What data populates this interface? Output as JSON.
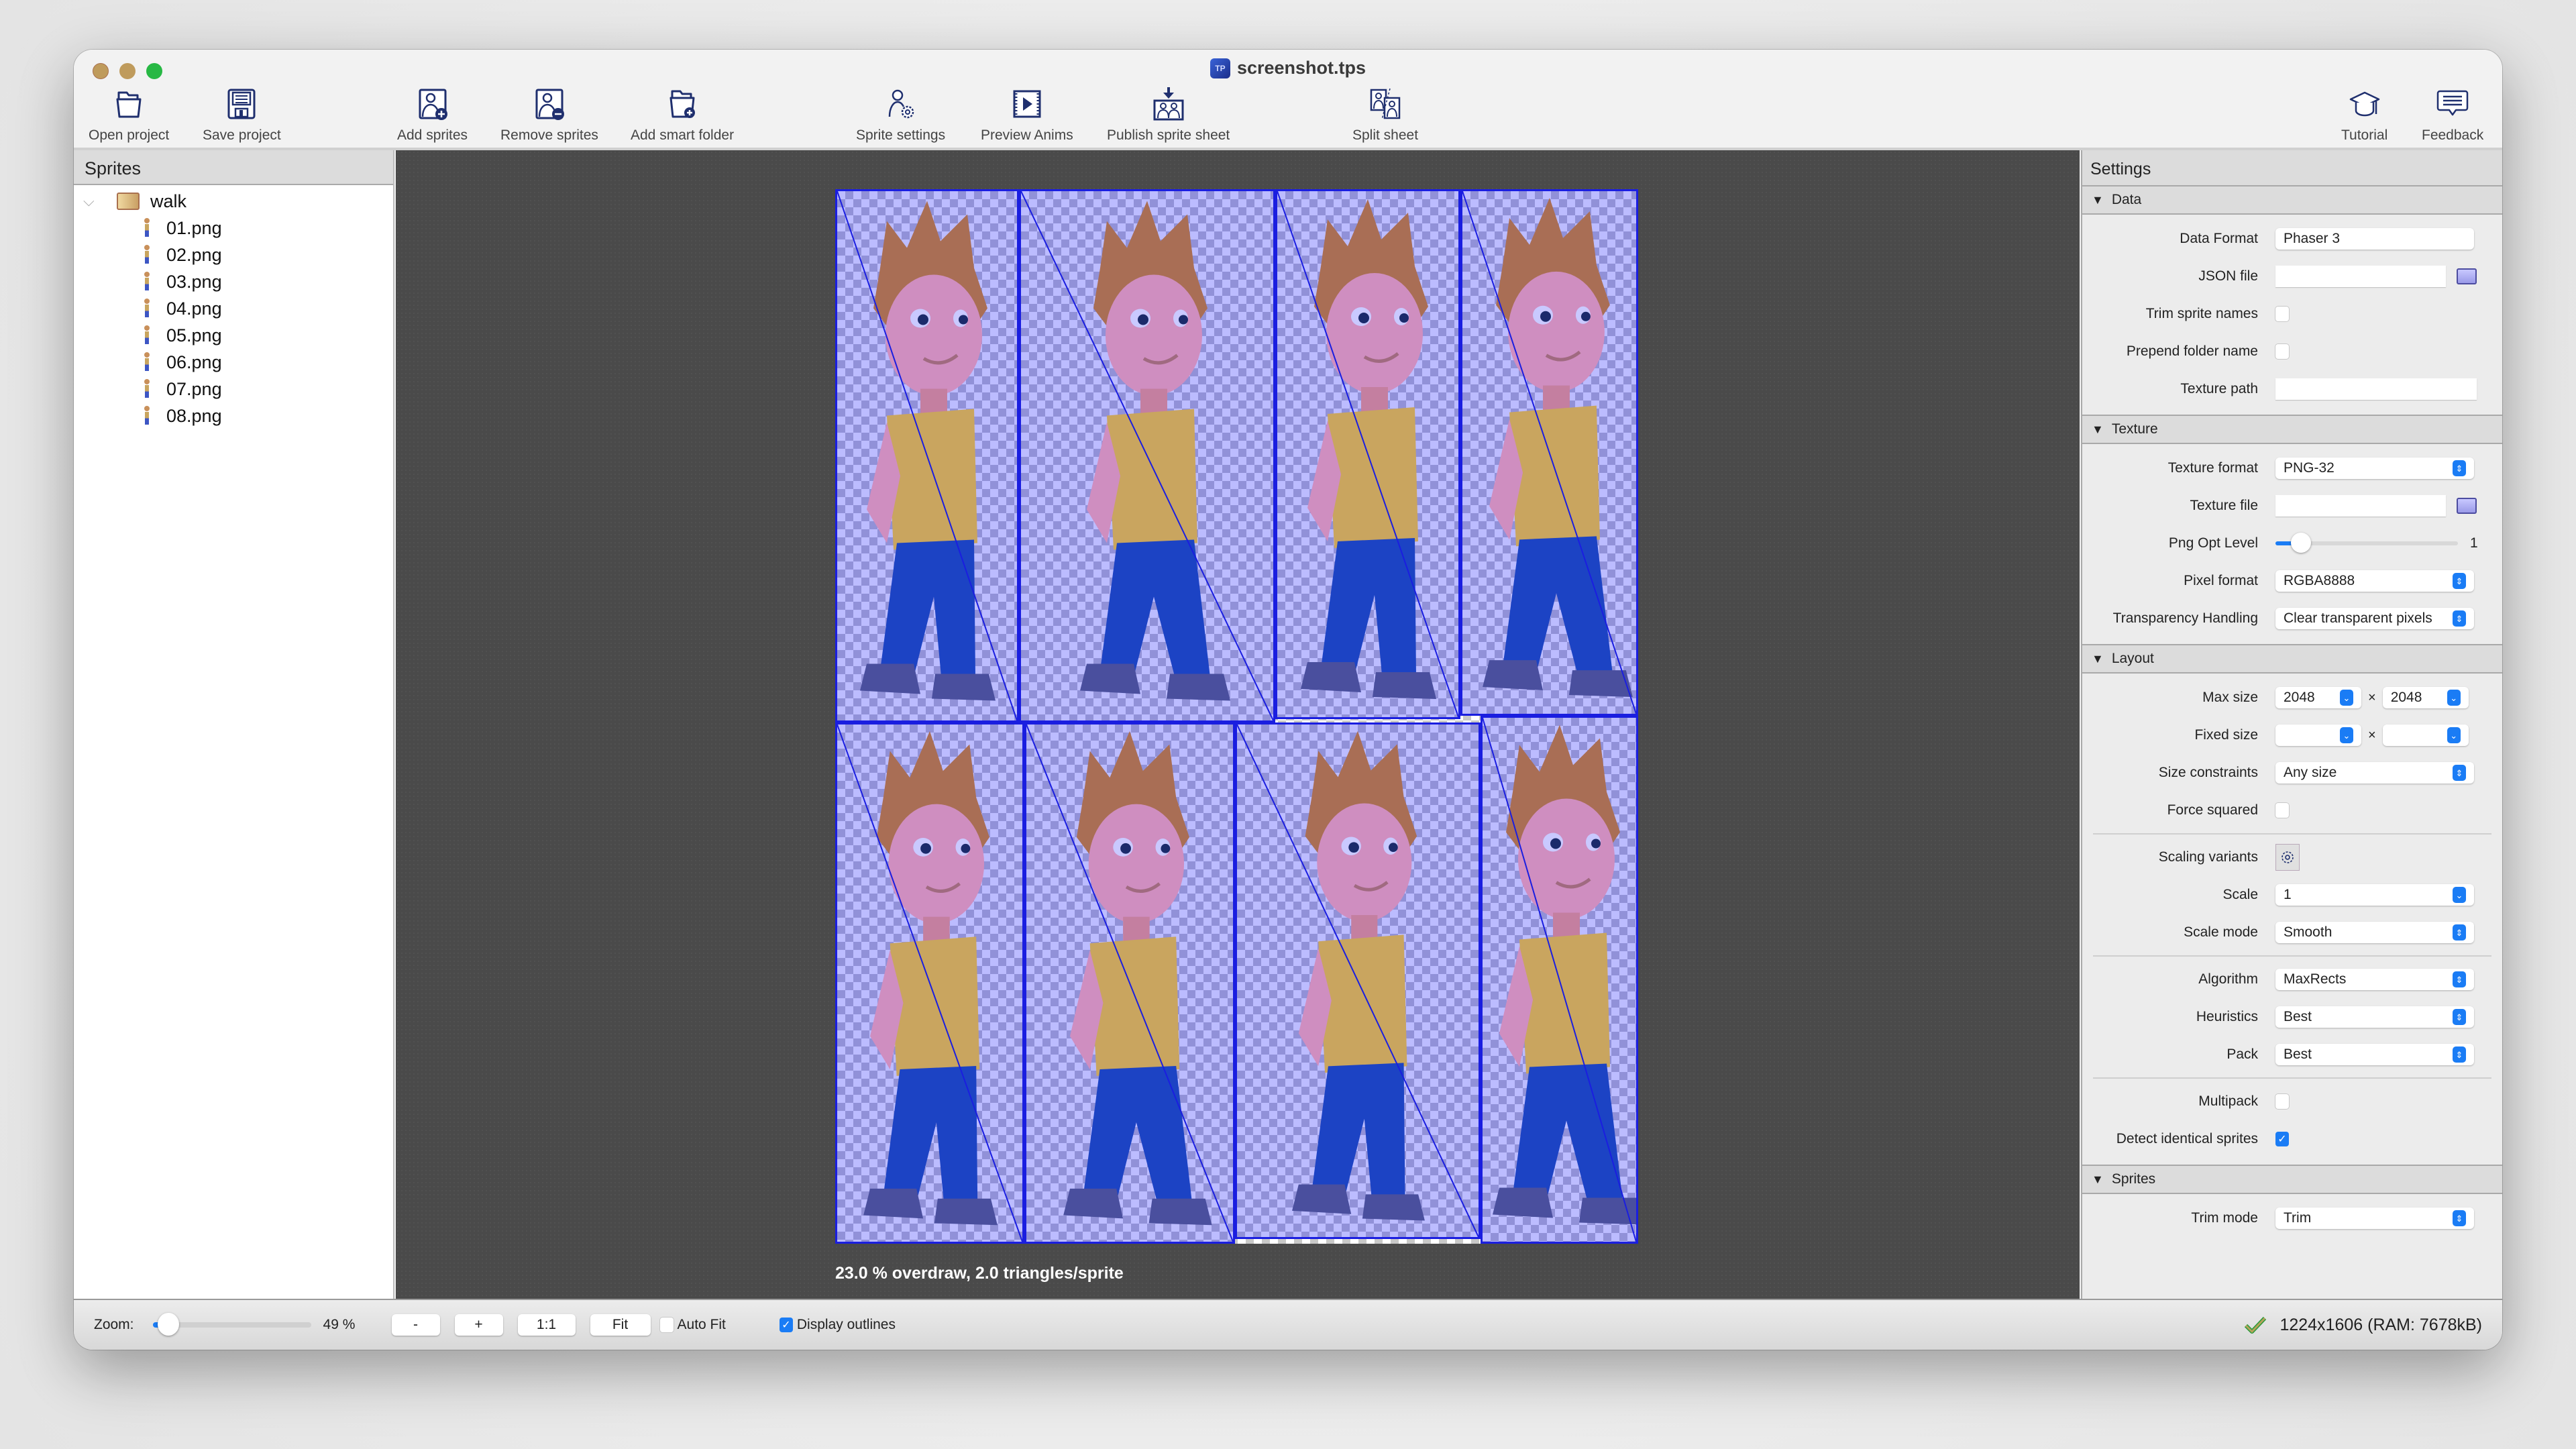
{
  "window": {
    "title": "screenshot.tps",
    "app_icon_text": "TP"
  },
  "toolbar": [
    {
      "id": "open-project",
      "label": "Open project",
      "icon": "folder-icon"
    },
    {
      "id": "save-project",
      "label": "Save project",
      "icon": "floppy-disk-icon"
    },
    {
      "id": "add-sprites",
      "label": "Add sprites",
      "icon": "add-sprite-icon"
    },
    {
      "id": "remove-sprites",
      "label": "Remove sprites",
      "icon": "remove-sprite-icon"
    },
    {
      "id": "add-smart-folder",
      "label": "Add smart folder",
      "icon": "add-folder-icon"
    },
    {
      "id": "sprite-settings",
      "label": "Sprite settings",
      "icon": "sprite-settings-icon"
    },
    {
      "id": "preview-anims",
      "label": "Preview Anims",
      "icon": "play-film-icon"
    },
    {
      "id": "publish-sprite-sheet",
      "label": "Publish sprite sheet",
      "icon": "publish-icon"
    },
    {
      "id": "split-sheet",
      "label": "Split sheet",
      "icon": "split-sheet-icon"
    },
    {
      "id": "tutorial",
      "label": "Tutorial",
      "icon": "graduation-cap-icon"
    },
    {
      "id": "feedback",
      "label": "Feedback",
      "icon": "speech-bubble-icon"
    }
  ],
  "sprites_panel": {
    "header": "Sprites",
    "folder": "walk",
    "files": [
      "01.png",
      "02.png",
      "03.png",
      "04.png",
      "05.png",
      "06.png",
      "07.png",
      "08.png"
    ]
  },
  "canvas": {
    "overdraw_text": "23.0 % overdraw, 2.0 triangles/sprite",
    "outline_color": "#1a1ee0"
  },
  "settings": {
    "header": "Settings",
    "data": {
      "title": "Data",
      "data_format_label": "Data Format",
      "data_format": "Phaser 3",
      "json_file_label": "JSON file",
      "json_file": "",
      "trim_sprite_names_label": "Trim sprite names",
      "trim_sprite_names": false,
      "prepend_folder_name_label": "Prepend folder name",
      "prepend_folder_name": false,
      "texture_path_label": "Texture path",
      "texture_path": ""
    },
    "texture": {
      "title": "Texture",
      "texture_format_label": "Texture format",
      "texture_format": "PNG-32",
      "texture_file_label": "Texture file",
      "texture_file": "",
      "png_opt_level_label": "Png Opt Level",
      "png_opt_level": "1",
      "png_opt_level_fraction": 0.14,
      "pixel_format_label": "Pixel format",
      "pixel_format": "RGBA8888",
      "transparency_label": "Transparency Handling",
      "transparency": "Clear transparent pixels"
    },
    "layout": {
      "title": "Layout",
      "max_size_label": "Max size",
      "max_w": "2048",
      "max_h": "2048",
      "times": "×",
      "fixed_size_label": "Fixed size",
      "fixed_w": "",
      "fixed_h": "",
      "size_constraints_label": "Size constraints",
      "size_constraints": "Any size",
      "force_squared_label": "Force squared",
      "force_squared": false,
      "scaling_variants_label": "Scaling variants",
      "scale_label": "Scale",
      "scale": "1",
      "scale_mode_label": "Scale mode",
      "scale_mode": "Smooth",
      "algorithm_label": "Algorithm",
      "algorithm": "MaxRects",
      "heuristics_label": "Heuristics",
      "heuristics": "Best",
      "pack_label": "Pack",
      "pack": "Best",
      "multipack_label": "Multipack",
      "multipack": false,
      "detect_identical_label": "Detect identical sprites",
      "detect_identical": true
    },
    "sprites": {
      "title": "Sprites",
      "trim_mode_label": "Trim mode",
      "trim_mode": "Trim"
    }
  },
  "bottombar": {
    "zoom_label": "Zoom:",
    "zoom_value": "49 %",
    "zoom_fraction": 0.1,
    "btn_minus": "-",
    "btn_plus": "+",
    "btn_1to1": "1:1",
    "btn_fit": "Fit",
    "auto_fit_label": "Auto Fit",
    "auto_fit": false,
    "display_outlines_label": "Display outlines",
    "display_outlines": true,
    "status": "1224x1606 (RAM: 7678kB)"
  },
  "colors": {
    "accent": "#1a7cf5",
    "icon_navy": "#1f2f6e",
    "status_ok": "#2a9a3a"
  }
}
